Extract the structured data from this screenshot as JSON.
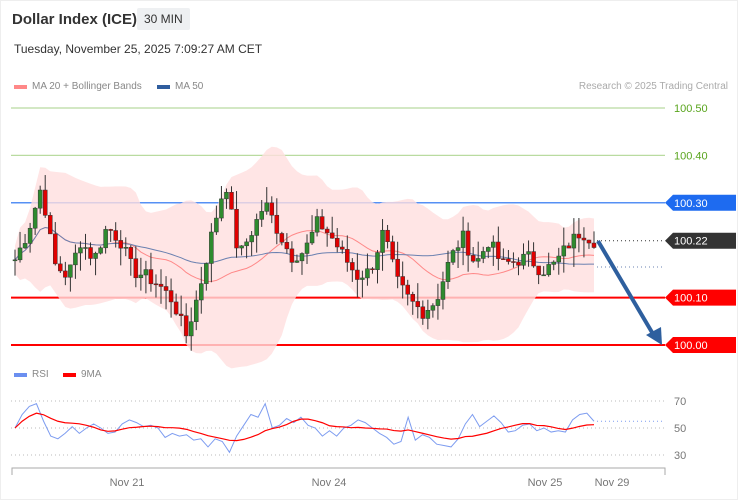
{
  "header": {
    "title": "Dollar Index (ICE)",
    "timeframe": "30 MIN",
    "datetime": "Tuesday, November 25, 2025 7:09:27 AM CET"
  },
  "legend": {
    "ma20": "MA 20 + Bollinger Bands",
    "ma50": "MA 50",
    "copyright": "Research © 2025 Trading Central"
  },
  "levels": [
    {
      "value": "100.50",
      "type": "target",
      "color": "#5aa51e"
    },
    {
      "value": "100.40",
      "type": "target",
      "color": "#5aa51e"
    },
    {
      "value": "100.30",
      "type": "resistance",
      "color": "#1e6bf0"
    },
    {
      "value": "100.22",
      "type": "last",
      "color": "#333333"
    },
    {
      "value": "100.10",
      "type": "support",
      "color": "#ff0000"
    },
    {
      "value": "100.00",
      "type": "support",
      "color": "#ff0000"
    }
  ],
  "price_keypoints": [
    100.18,
    100.24,
    100.335,
    100.17,
    100.145,
    100.22,
    100.18,
    100.25,
    100.22,
    100.155,
    100.145,
    100.125,
    100.093,
    100.02,
    100.115,
    100.24,
    100.346,
    100.186,
    100.24,
    100.3,
    100.24,
    100.186,
    100.198,
    100.26,
    100.23,
    100.186,
    100.145,
    100.156,
    100.24,
    100.135,
    100.093,
    100.07,
    100.093,
    100.177,
    100.23,
    100.17,
    100.22,
    100.17,
    100.177,
    100.186,
    100.156,
    100.17,
    100.21,
    100.24,
    100.22
  ],
  "rsi_panel": {
    "rsi_label": "RSI",
    "ma_label": "9MA",
    "ticks": [
      "70",
      "50",
      "30"
    ],
    "rsi": [
      50,
      60,
      66,
      68,
      55,
      44,
      42,
      46,
      51,
      46,
      50,
      53,
      50,
      46,
      47,
      53,
      56,
      54,
      51,
      52,
      50,
      43,
      46,
      44,
      45,
      41,
      42,
      36,
      42,
      40,
      32,
      44,
      52,
      60,
      58,
      68,
      50,
      52,
      57,
      54,
      58,
      52,
      50,
      44,
      48,
      44,
      50,
      52,
      56,
      54,
      50,
      46,
      43,
      38,
      40,
      58,
      41,
      45,
      43,
      38,
      37,
      36,
      42,
      53,
      60,
      51,
      55,
      59,
      54,
      47,
      48,
      52,
      53,
      48,
      50,
      47,
      48,
      47,
      56,
      60,
      61,
      55
    ]
  },
  "xaxis": {
    "labels": [
      "Nov 21",
      "Nov 24",
      "Nov 25",
      "Nov 29"
    ]
  }
}
